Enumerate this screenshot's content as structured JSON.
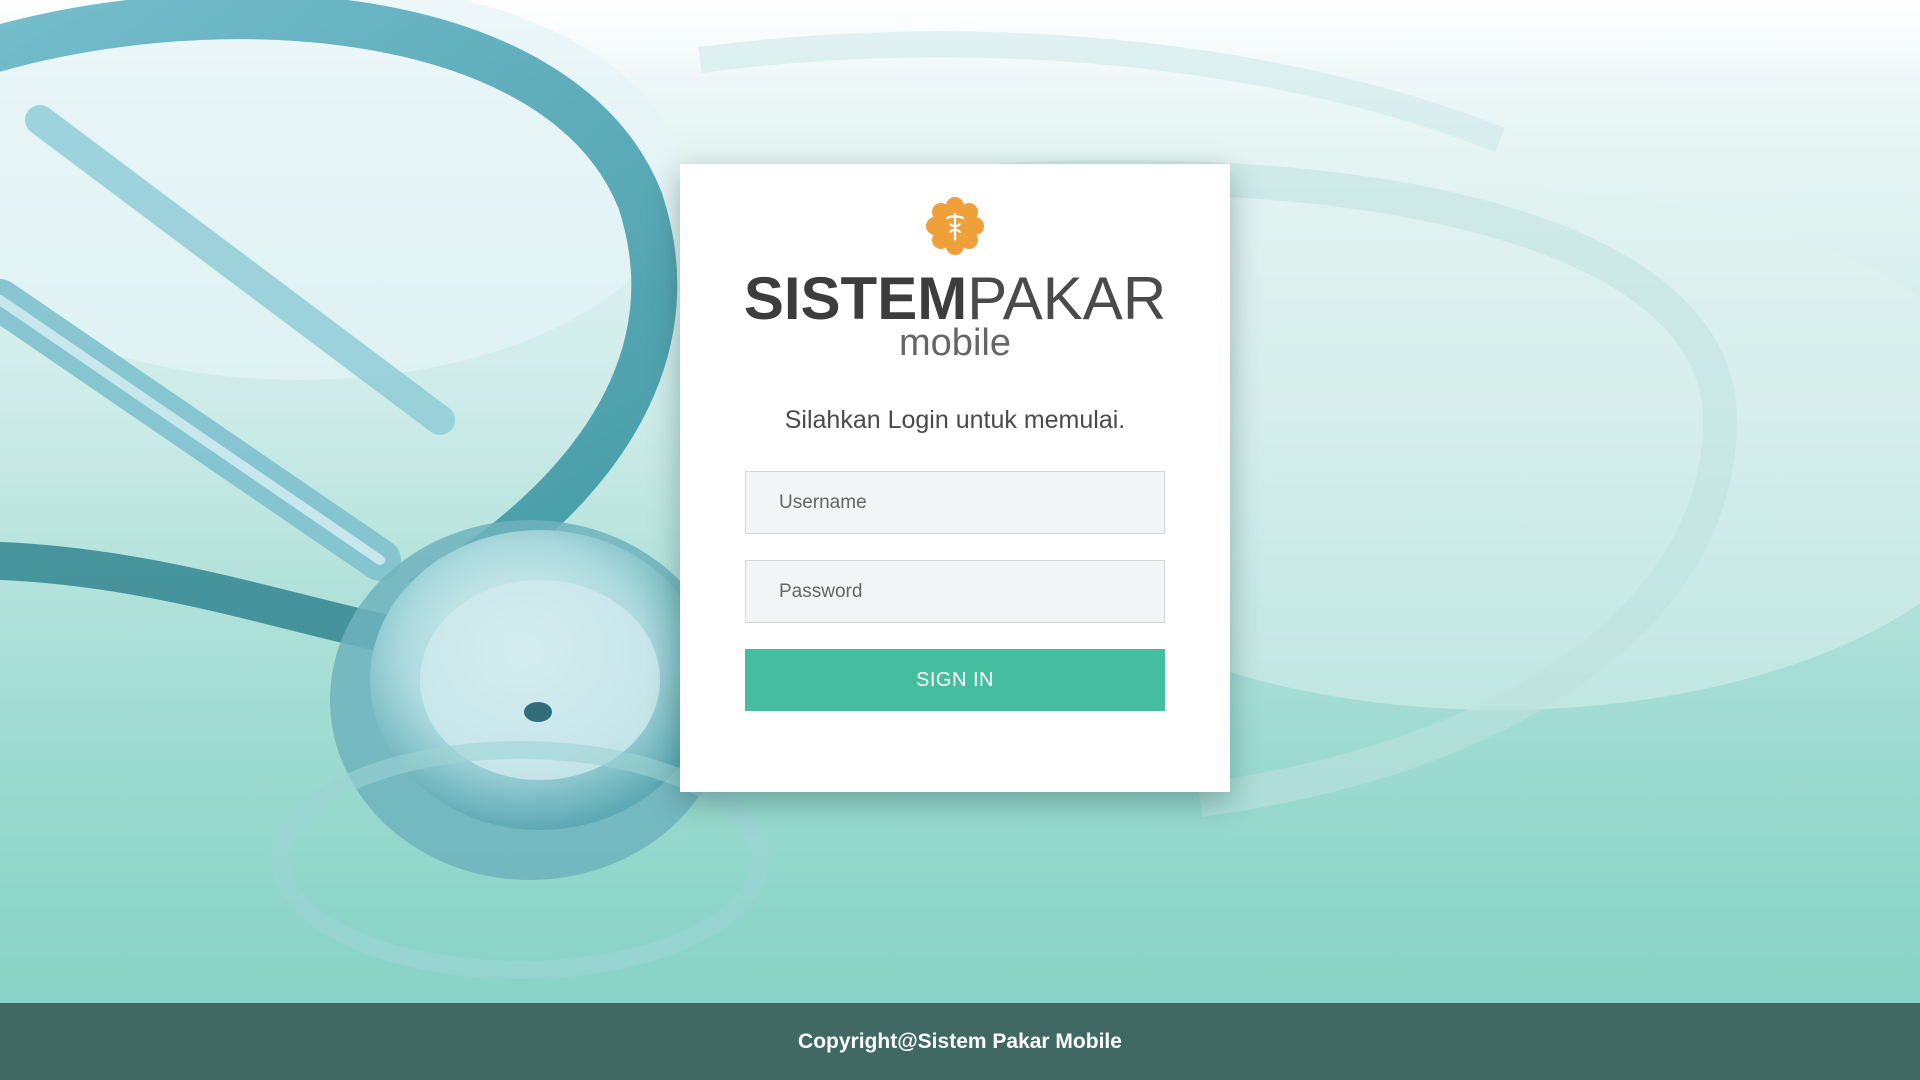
{
  "brand": {
    "name_bold": "SISTEM",
    "name_light": "PAKAR",
    "subtitle": "mobile",
    "logo_icon": "medical-flower-icon",
    "logo_color": "#f0a03a"
  },
  "login": {
    "prompt": "Silahkan Login untuk memulai.",
    "username_placeholder": "Username",
    "username_value": "",
    "password_placeholder": "Password",
    "password_value": "",
    "submit_label": "SIGN IN",
    "accent_color": "#45bd9f"
  },
  "background": {
    "image": "stethoscope-photo"
  },
  "footer": {
    "copyright": "Copyright@Sistem Pakar Mobile",
    "color": "#416963"
  }
}
